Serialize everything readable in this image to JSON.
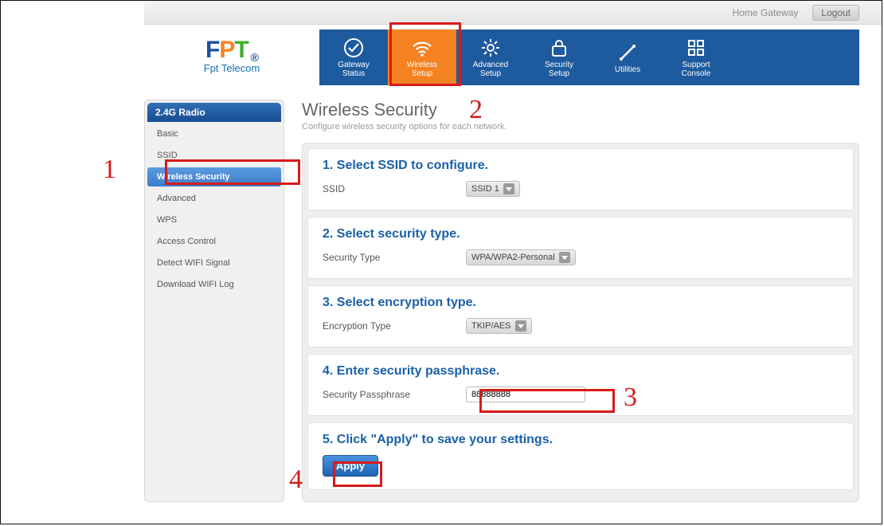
{
  "topbar": {
    "home_label": "Home Gateway",
    "logout_label": "Logout"
  },
  "logo": {
    "f": "F",
    "p": "P",
    "t": "T",
    "dot": "®",
    "sub": "Fpt Telecom"
  },
  "nav": {
    "items": [
      {
        "label": "Gateway\nStatus",
        "icon": "check-circle-icon"
      },
      {
        "label": "Wireless\nSetup",
        "icon": "wifi-icon",
        "active": true
      },
      {
        "label": "Advanced\nSetup",
        "icon": "gear-icon"
      },
      {
        "label": "Security\nSetup",
        "icon": "lock-icon"
      },
      {
        "label": "Utilities",
        "icon": "tools-icon"
      },
      {
        "label": "Support\nConsole",
        "icon": "grid-icon"
      }
    ]
  },
  "sidebar": {
    "header": "2.4G Radio",
    "items": [
      {
        "label": "Basic"
      },
      {
        "label": "SSID"
      },
      {
        "label": "Wireless Security",
        "selected": true
      },
      {
        "label": "Advanced"
      },
      {
        "label": "WPS"
      },
      {
        "label": "Access Control"
      },
      {
        "label": "Detect WIFI Signal"
      },
      {
        "label": "Download WIFI Log"
      }
    ]
  },
  "page": {
    "title": "Wireless Security",
    "subtitle": "Configure wireless security options for each network."
  },
  "sections": [
    {
      "heading": "1. Select SSID to configure.",
      "field_label": "SSID",
      "field_value": "SSID 1",
      "type": "dropdown"
    },
    {
      "heading": "2. Select security type.",
      "field_label": "Security Type",
      "field_value": "WPA/WPA2-Personal",
      "type": "dropdown"
    },
    {
      "heading": "3. Select encryption type.",
      "field_label": "Encryption Type",
      "field_value": "TKIP/AES",
      "type": "dropdown"
    },
    {
      "heading": "4. Enter security passphrase.",
      "field_label": "Security Passphrase",
      "field_value": "88888888",
      "type": "text"
    },
    {
      "heading": "5. Click \"Apply\" to save your settings.",
      "button_label": "Apply",
      "type": "button"
    }
  ],
  "annotations": {
    "n1": "1",
    "n2": "2",
    "n3": "3",
    "n4": "4"
  }
}
